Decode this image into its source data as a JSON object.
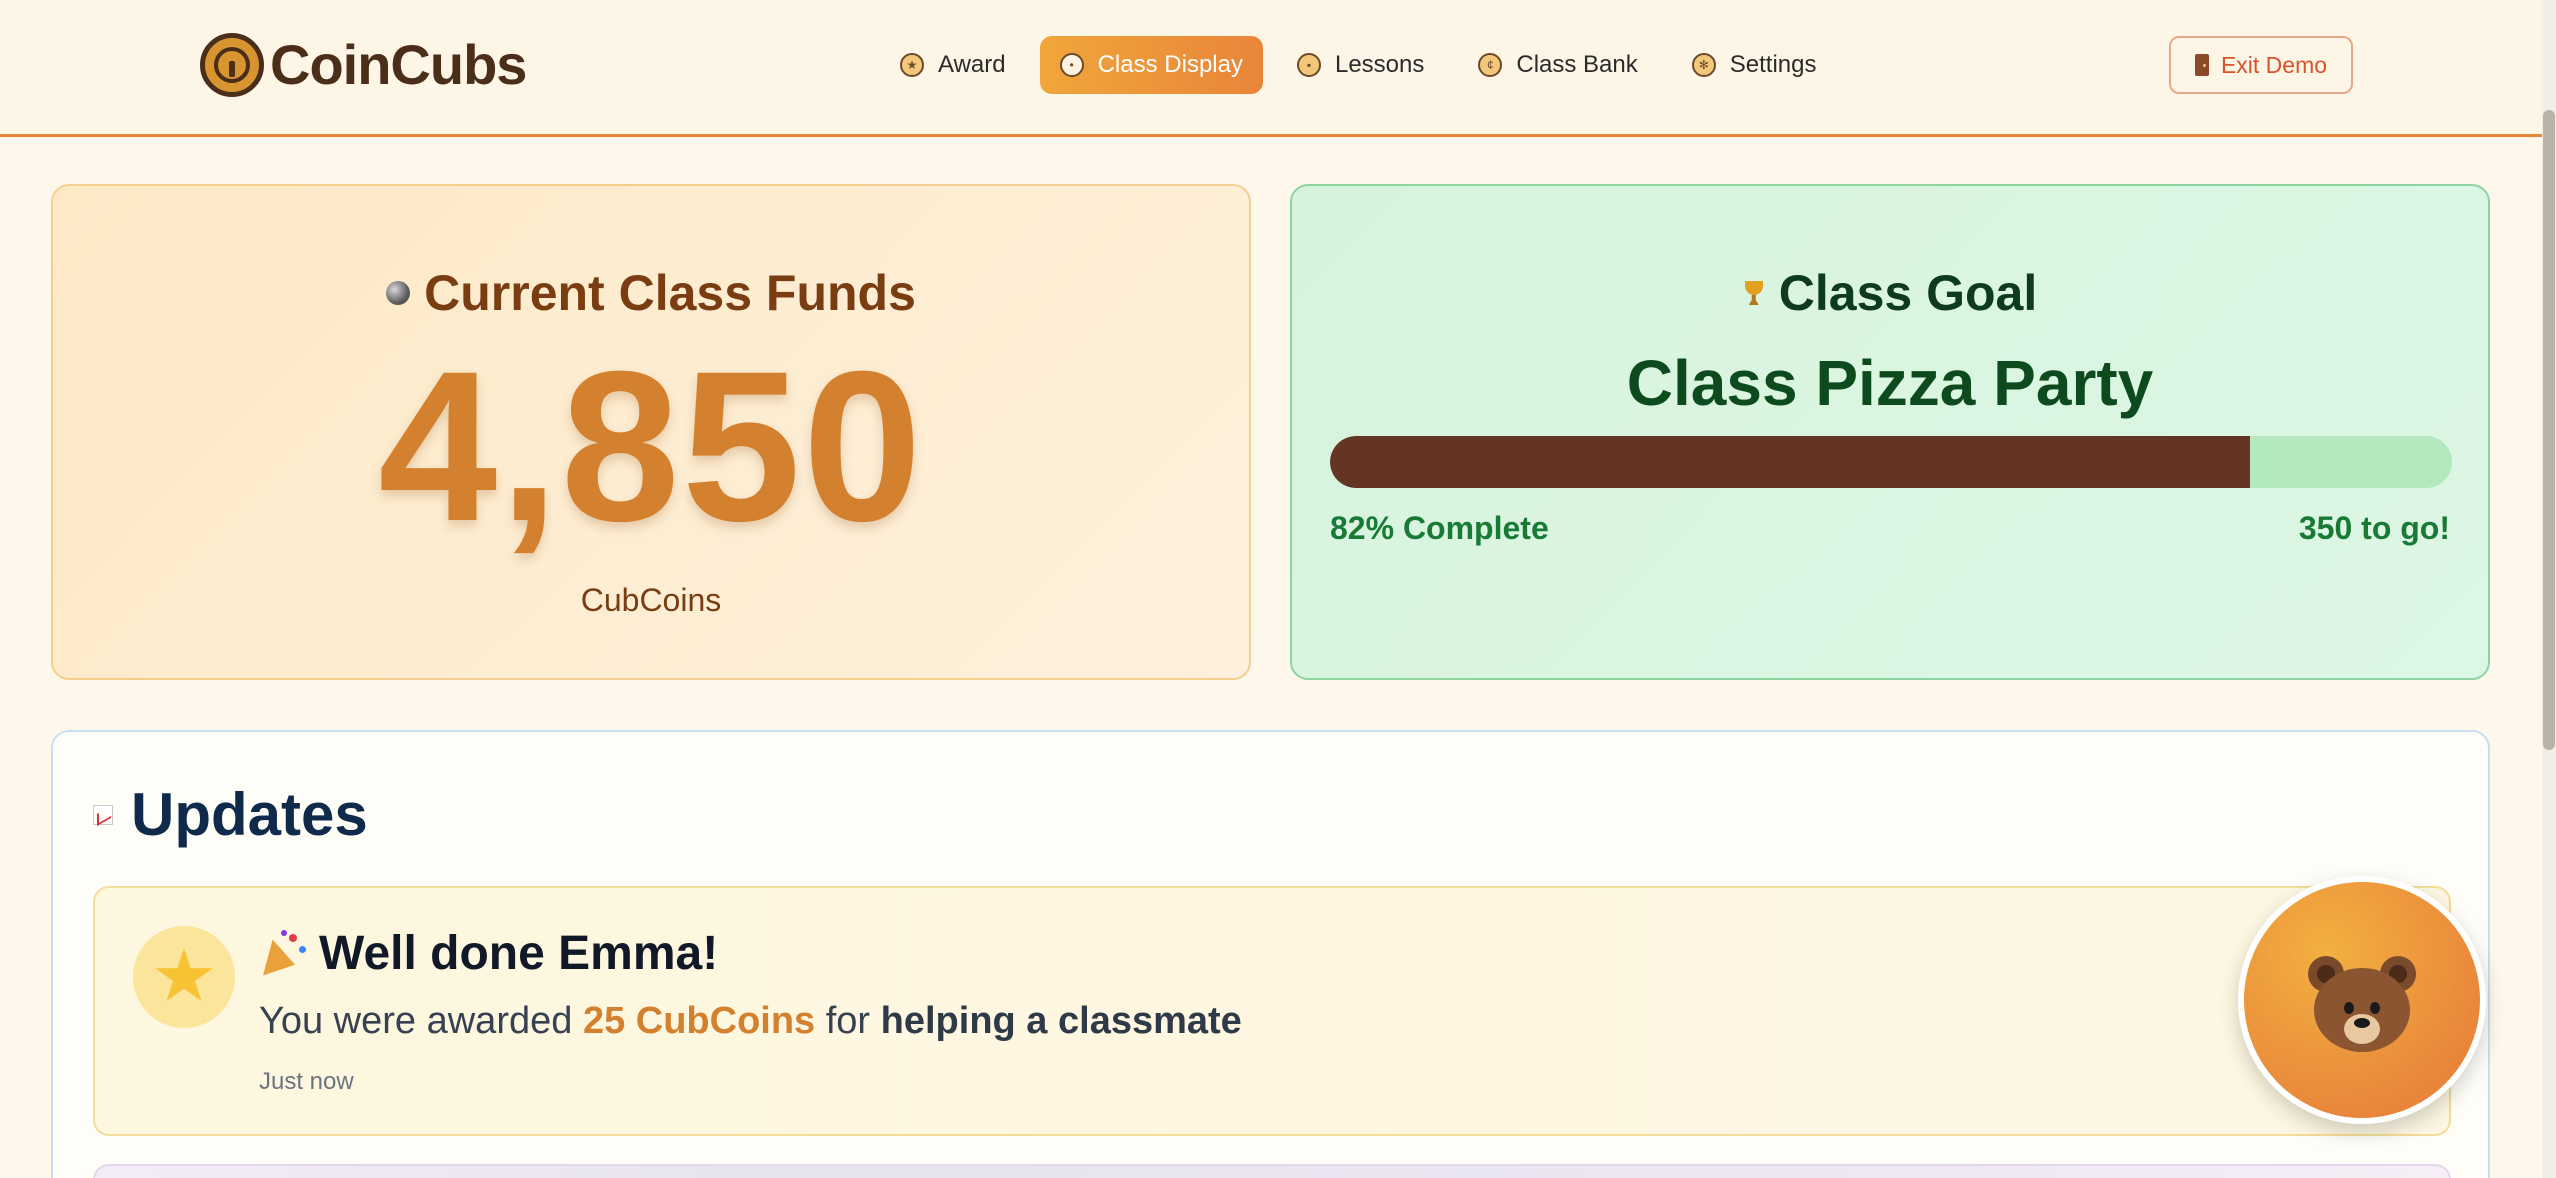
{
  "header": {
    "logo_text": "CoinCubs",
    "nav": [
      {
        "label": "Award",
        "icon": "trophy-icon",
        "active": false
      },
      {
        "label": "Class Display",
        "icon": "display-icon",
        "active": true
      },
      {
        "label": "Lessons",
        "icon": "book-icon",
        "active": false
      },
      {
        "label": "Class Bank",
        "icon": "bank-coin-icon",
        "active": false
      },
      {
        "label": "Settings",
        "icon": "gear-icon",
        "active": false
      }
    ],
    "exit_label": "Exit Demo"
  },
  "funds": {
    "title": "Current Class Funds",
    "amount": "4,850",
    "unit": "CubCoins"
  },
  "goal": {
    "title": "Class Goal",
    "name": "Class Pizza Party",
    "progress_fraction": 0.82,
    "progress_text": "82% Complete",
    "remaining_text": "350 to go!"
  },
  "updates": {
    "title": "Updates",
    "items": [
      {
        "title": "Well done Emma!",
        "message_prefix": "You were awarded ",
        "amount": "25 CubCoins",
        "message_middle": " for ",
        "reason": "helping a classmate",
        "time": "Just now"
      }
    ]
  },
  "colors": {
    "accent": "#e9853a",
    "funds_amount": "#d3812e",
    "goal_fill": "#643522",
    "goal_track": "#b4e8bf"
  }
}
